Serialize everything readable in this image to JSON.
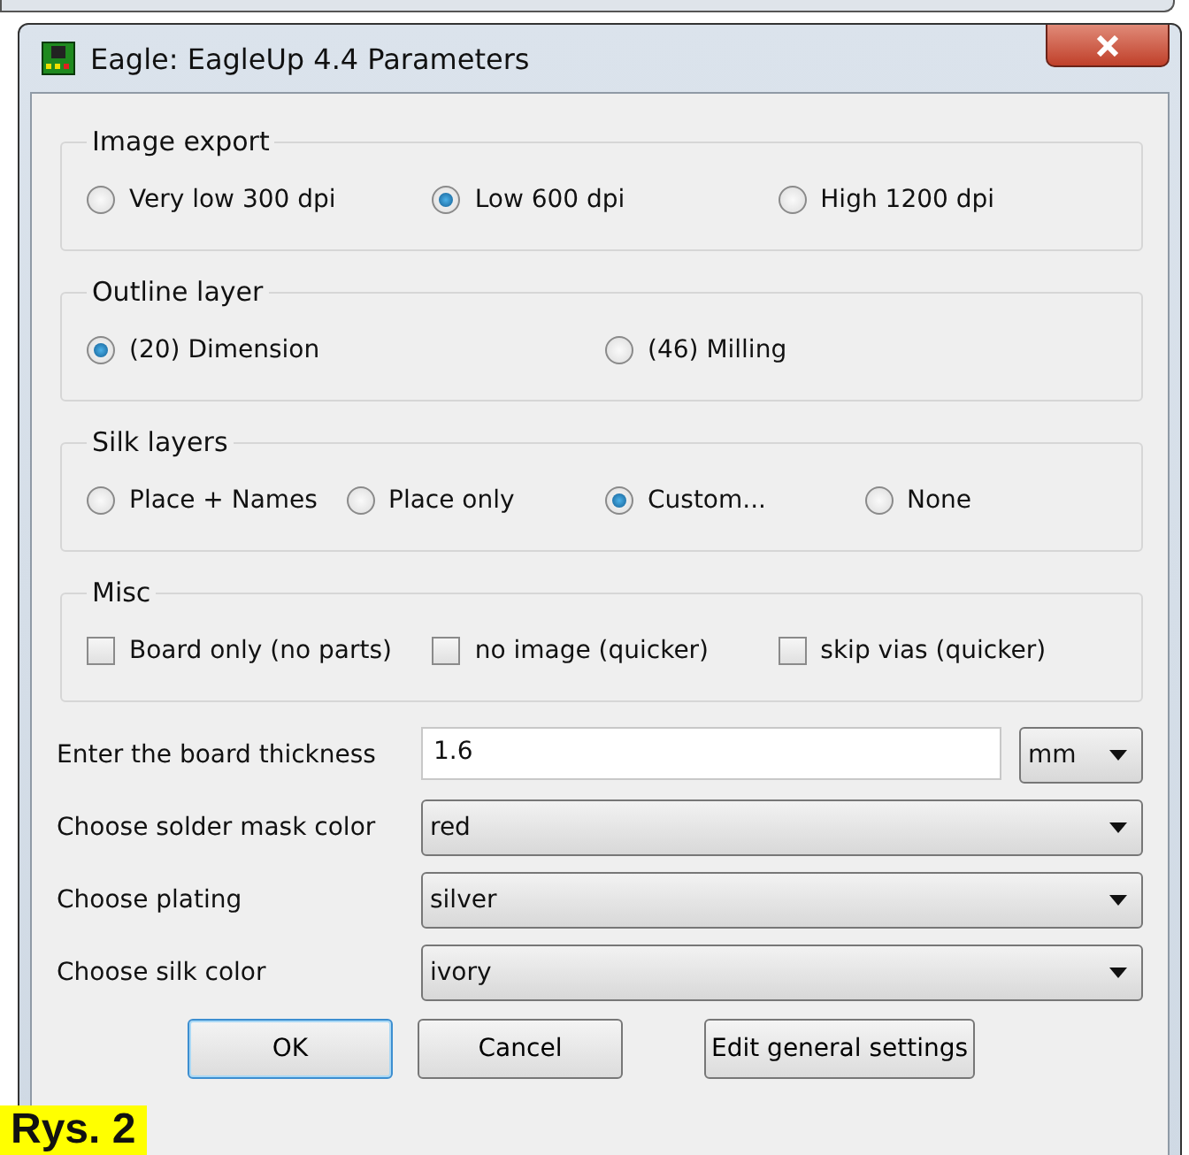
{
  "window": {
    "title": "Eagle: EagleUp 4.4 Parameters"
  },
  "groups": [
    {
      "title": "Image export",
      "kind": "radio",
      "options": [
        {
          "label": "Very low 300 dpi",
          "selected": false
        },
        {
          "label": "Low 600 dpi",
          "selected": true
        },
        {
          "label": "High 1200 dpi",
          "selected": false
        }
      ]
    },
    {
      "title": "Outline layer",
      "kind": "radio",
      "options": [
        {
          "label": "(20) Dimension",
          "selected": true
        },
        {
          "label": "(46) Milling",
          "selected": false
        }
      ]
    },
    {
      "title": "Silk layers",
      "kind": "radio",
      "options": [
        {
          "label": "Place + Names",
          "selected": false
        },
        {
          "label": "Place only",
          "selected": false
        },
        {
          "label": "Custom...",
          "selected": true
        },
        {
          "label": "None",
          "selected": false
        }
      ]
    },
    {
      "title": "Misc",
      "kind": "checkbox",
      "options": [
        {
          "label": "Board only (no parts)",
          "checked": false
        },
        {
          "label": "no image (quicker)",
          "checked": false
        },
        {
          "label": "skip vias (quicker)",
          "checked": false
        }
      ]
    }
  ],
  "fields": [
    {
      "label": "Enter the board thickness",
      "kind": "input",
      "value": "1.6",
      "unit": "mm"
    },
    {
      "label": "Choose solder mask color",
      "kind": "select",
      "value": "red"
    },
    {
      "label": "Choose plating",
      "kind": "select",
      "value": "silver"
    },
    {
      "label": "Choose silk color",
      "kind": "select",
      "value": "ivory"
    }
  ],
  "buttons": [
    {
      "label": "OK",
      "default": true
    },
    {
      "label": "Cancel",
      "default": false
    },
    {
      "label": "Edit general settings",
      "default": false
    }
  ],
  "caption": "Rys. 2"
}
